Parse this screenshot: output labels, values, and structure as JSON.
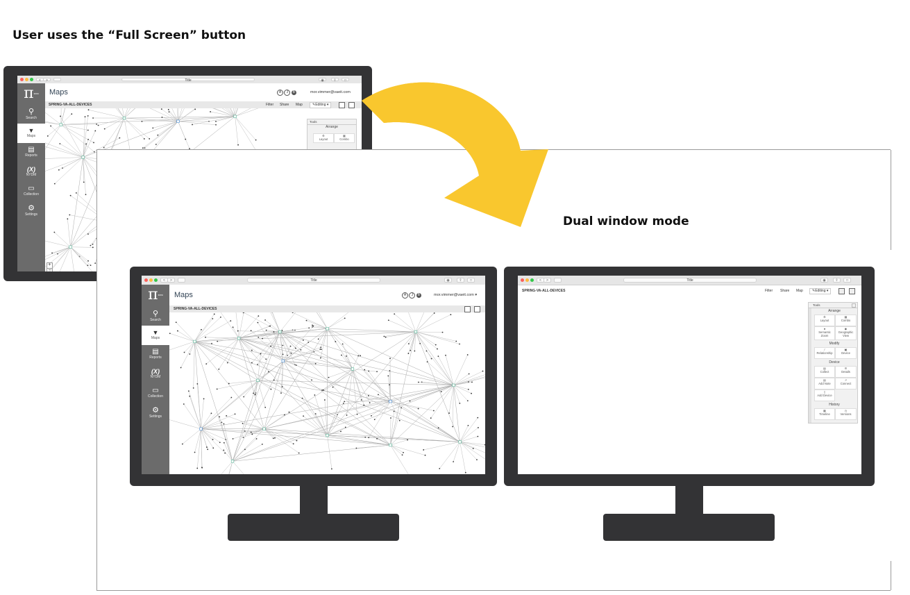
{
  "heading_top": "User uses the “Full Screen” button",
  "heading_right": "Dual window mode",
  "colors": {
    "arrow": "#F9C72E",
    "bezel": "#333335",
    "sidebar": "#6b6b6b",
    "chrome": "#e6e6e6",
    "node_green": "#58b89a",
    "node_blue": "#4a90d9"
  },
  "browser": {
    "tab_title": "Title"
  },
  "app": {
    "logo": "π",
    "logo_suffix": "srvc",
    "page_title": "Maps",
    "map_name": "SPRING-VA-ALL-DEVICES",
    "user_email": "mor.vimmer@vaeit.com",
    "user_email_small": "mor.vimmer@vaeit.com",
    "avatars": [
      "A",
      "J",
      "B"
    ],
    "sidebar": [
      {
        "label": "Search",
        "icon": "search-icon",
        "glyph": "⚲"
      },
      {
        "label": "Maps",
        "icon": "map-pin-icon",
        "glyph": "▼"
      },
      {
        "label": "Reports",
        "icon": "report-icon",
        "glyph": "▤"
      },
      {
        "label": "NYDM",
        "icon": "variable-icon",
        "glyph": "(X)"
      },
      {
        "label": "Collection",
        "icon": "folder-icon",
        "glyph": "▭"
      },
      {
        "label": "Settings",
        "icon": "gear-icon",
        "glyph": "⚙"
      }
    ],
    "toolbar": {
      "filter": "Filter",
      "share": "Share",
      "map": "Map",
      "editing": "Editing"
    },
    "zoom": {
      "plus": "+",
      "minus": "−"
    }
  },
  "tools_panel": {
    "title": "Tools",
    "sections": {
      "arrange": "Arrange",
      "modify": "Modify",
      "device": "Device",
      "history": "History"
    },
    "buttons": {
      "layout": "Layout",
      "combo": "Combo",
      "semantic_zoom": "Semantic Zoom",
      "geographic_view": "Geographic View",
      "relationship": "Relationship",
      "device": "Device",
      "collect": "Collect",
      "details": "Details",
      "add_note": "Add Note",
      "connect": "Connect",
      "add_device": "Add Device",
      "timeline": "Timeline",
      "versions": "Versions"
    }
  }
}
